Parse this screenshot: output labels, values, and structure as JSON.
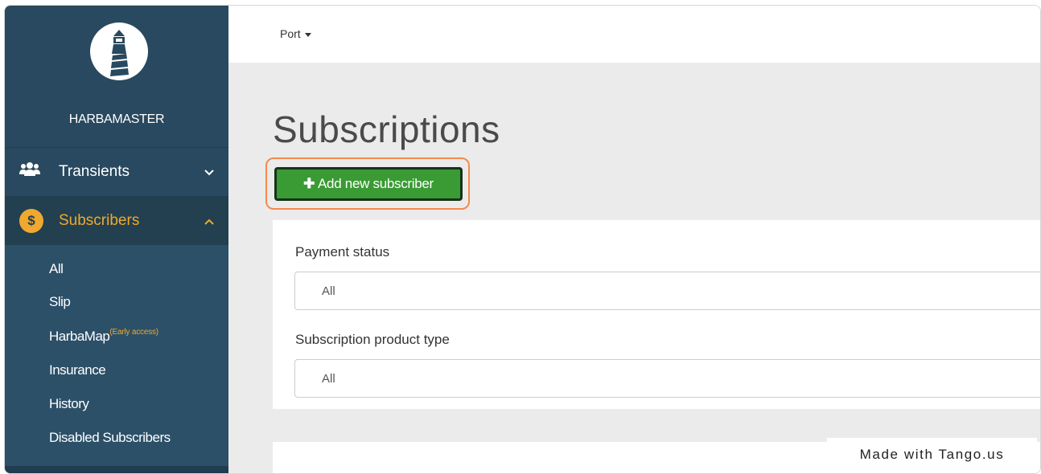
{
  "sidebar": {
    "brand": "HARBAMASTER",
    "nav": {
      "transients": "Transients",
      "subscribers": "Subscribers",
      "dollar_symbol": "$"
    },
    "submenu": {
      "all": "All",
      "slip": "Slip",
      "harbamap": "HarbaMap",
      "harbamap_badge": "(Early access)",
      "insurance": "Insurance",
      "history": "History",
      "disabled": "Disabled Subscribers"
    },
    "icons": {
      "logo": "lighthouse-logo-icon",
      "transients": "users-icon",
      "subscribers": "dollar-icon",
      "transients_chevron": "chevron-down-icon",
      "subscribers_chevron": "chevron-up-icon"
    }
  },
  "topbar": {
    "port_label": "Port"
  },
  "main": {
    "title": "Subscriptions",
    "add_button": "Add new subscriber",
    "filters": {
      "payment_status_label": "Payment status",
      "payment_status_value": "All",
      "product_type_label": "Subscription product type",
      "product_type_value": "All"
    }
  },
  "watermark": "Made with Tango.us",
  "colors": {
    "sidebar": "#28495f",
    "accent": "#f0a830",
    "button": "#3a9a34",
    "highlight": "#f58a4a"
  }
}
